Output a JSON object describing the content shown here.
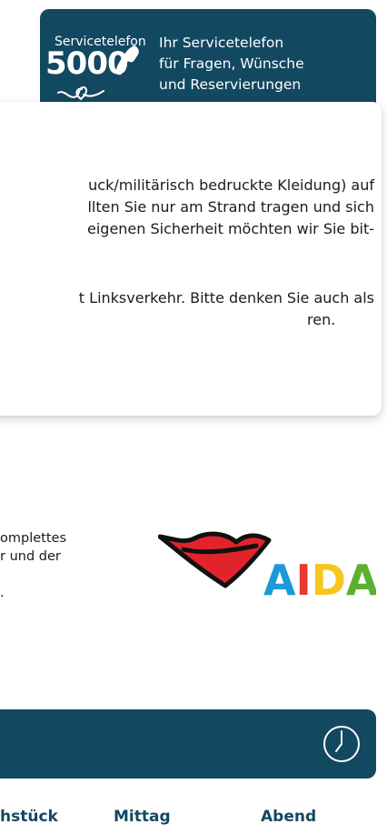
{
  "banner": {
    "service_label": "Servicetelefon",
    "service_number": "5000",
    "lines": [
      "Ihr Servicetelefon",
      "für Fragen, Wünsche",
      "und Reservierungen"
    ]
  },
  "notice": {
    "paragraph1": [
      "uck/militärisch bedruckte Kleidung) auf",
      "llten Sie nur am Strand tragen und sich",
      "eigenen Sicherheit möchten wir Sie bit-"
    ],
    "paragraph2": [
      "t Linksverkehr. Bitte denken Sie auch als",
      "ren."
    ]
  },
  "ship_info": {
    "lines": [
      "omplettes",
      "r und der",
      "."
    ]
  },
  "logo": {
    "text": "AIDA",
    "letter_colors": [
      "#1a9ad6",
      "#e53a2f",
      "#f7c51e",
      "#5bb030"
    ]
  },
  "schedule_bar": {
    "clock_icon": "clock-icon"
  },
  "meal_tabs": [
    "hstück",
    "Mittag",
    "Abend"
  ],
  "colors": {
    "primary": "#134861",
    "lips_red": "#e3232b"
  }
}
